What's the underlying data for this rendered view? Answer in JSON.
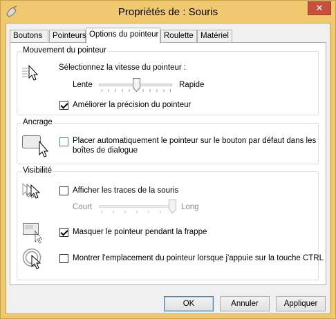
{
  "window": {
    "title": "Propriétés de : Souris",
    "close_glyph": "✕"
  },
  "tabs": [
    {
      "label": "Boutons"
    },
    {
      "label": "Pointeurs"
    },
    {
      "label": "Options du pointeur"
    },
    {
      "label": "Roulette"
    },
    {
      "label": "Matériel"
    }
  ],
  "active_tab": "Options du pointeur",
  "motion": {
    "title": "Mouvement du pointeur",
    "speed_label": "Sélectionnez la vitesse du pointeur :",
    "slow_label": "Lente",
    "fast_label": "Rapide",
    "speed_level": 0.5,
    "precision_label": "Améliorer la précision du pointeur",
    "precision_checked": true
  },
  "snap": {
    "title": "Ancrage",
    "snap_label_line1": "Placer automatiquement le pointeur sur le bouton par défaut dans les",
    "snap_label_line2": "boîtes de dialogue",
    "snap_checked": false
  },
  "visibility": {
    "title": "Visibilité",
    "trails_label": "Afficher les traces de la souris",
    "trails_checked": false,
    "short_label": "Court",
    "long_label": "Long",
    "trail_length_level": 1.0,
    "hide_label": "Masquer le pointeur pendant la frappe",
    "hide_checked": true,
    "ctrl_label": "Montrer l'emplacement du pointeur lorsque j'appuie sur la touche CTRL",
    "ctrl_checked": false
  },
  "buttons": {
    "ok": "OK",
    "cancel": "Annuler",
    "apply": "Appliquer"
  },
  "colors": {
    "title_bar": "#f0c870",
    "close_button": "#c7503d",
    "focus_border": "#3c7fb1"
  }
}
